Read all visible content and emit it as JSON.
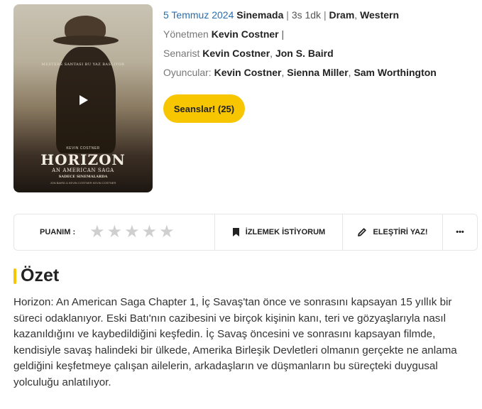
{
  "poster": {
    "tagline": "MESTERS SANTASI BU YAZ BASLIYOR",
    "credit_small": "KEVIN COSTNER",
    "title": "HORIZON",
    "subtitle": "AN AMERICAN SAGA",
    "note": "SADECE SINEMALARDA",
    "credits": "JON BAIRD & KEVIN COSTNER  KEVIN COSTNER",
    "play_icon": "play-icon"
  },
  "info": {
    "date": "5 Temmuz 2024",
    "status": "Sinemada",
    "duration": "3s 1dk",
    "genres": [
      "Dram",
      "Western"
    ],
    "director_label": "Yönetmen",
    "director": "Kevin Costner",
    "writer_label": "Senarist",
    "writers": [
      "Kevin Costner",
      "Jon S. Baird"
    ],
    "cast_label": "Oyuncular:",
    "cast": [
      "Kevin Costner",
      "Sienna Miller",
      "Sam Worthington"
    ]
  },
  "buttons": {
    "sessions": "Seanslar! (25)"
  },
  "actionbar": {
    "rating_label": "PUANIM :",
    "rating_value": 0,
    "rating_max": 5,
    "watchlist": "İZLEMEK İSTİYORUM",
    "review": "ELEŞTİRİ YAZ!",
    "more": "•••",
    "star_color": "#cfcfcf",
    "accent_color": "#f7c600"
  },
  "summary": {
    "title": "Özet",
    "text": "Horizon: An American Saga Chapter 1, İç Savaş'tan önce ve sonrasını kapsayan 15 yıllık bir süreci odaklanıyor. Eski Batı'nın cazibesini ve birçok kişinin kanı, teri ve gözyaşlarıyla nasıl kazanıldığını ve kaybedildiğini keşfedin. İç Savaş öncesini ve sonrasını kapsayan filmde, kendisiyle savaş halindeki bir ülkede, Amerika Birleşik Devletleri olmanın gerçekte ne anlama geldiğini keşfetmeye çalışan ailelerin, arkadaşların ve düşmanların bu süreçteki duygusal yolculuğu anlatılıyor."
  }
}
